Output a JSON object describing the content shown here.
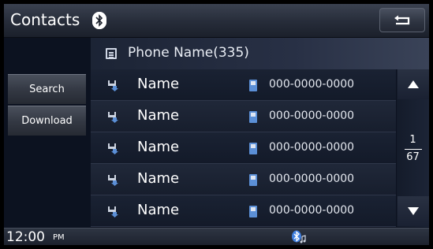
{
  "header": {
    "title": "Contacts"
  },
  "phonebook": {
    "label": "Phone Name(335)"
  },
  "menu": {
    "search_label": "Search",
    "download_label": "Download"
  },
  "contacts": [
    {
      "name": "Name",
      "number": "000-0000-0000"
    },
    {
      "name": "Name",
      "number": "000-0000-0000"
    },
    {
      "name": "Name",
      "number": "000-0000-0000"
    },
    {
      "name": "Name",
      "number": "000-0000-0000"
    },
    {
      "name": "Name",
      "number": "000-0000-0000"
    }
  ],
  "pagination": {
    "current": "1",
    "total": "67"
  },
  "status": {
    "time": "12:00",
    "ampm": "PM"
  },
  "icons": {
    "title_icon": "bluetooth-icon",
    "back": "back-arrow-icon",
    "phonebook": "phonebook-icon",
    "contact": "contact-download-icon",
    "phone": "mobile-phone-icon",
    "scroll_up": "triangle-up-icon",
    "scroll_down": "triangle-down-icon",
    "status": "bluetooth-audio-icon"
  },
  "colors": {
    "background": "#0c1220",
    "header": "#262c39",
    "icon_accent": "#5b8fd6"
  }
}
